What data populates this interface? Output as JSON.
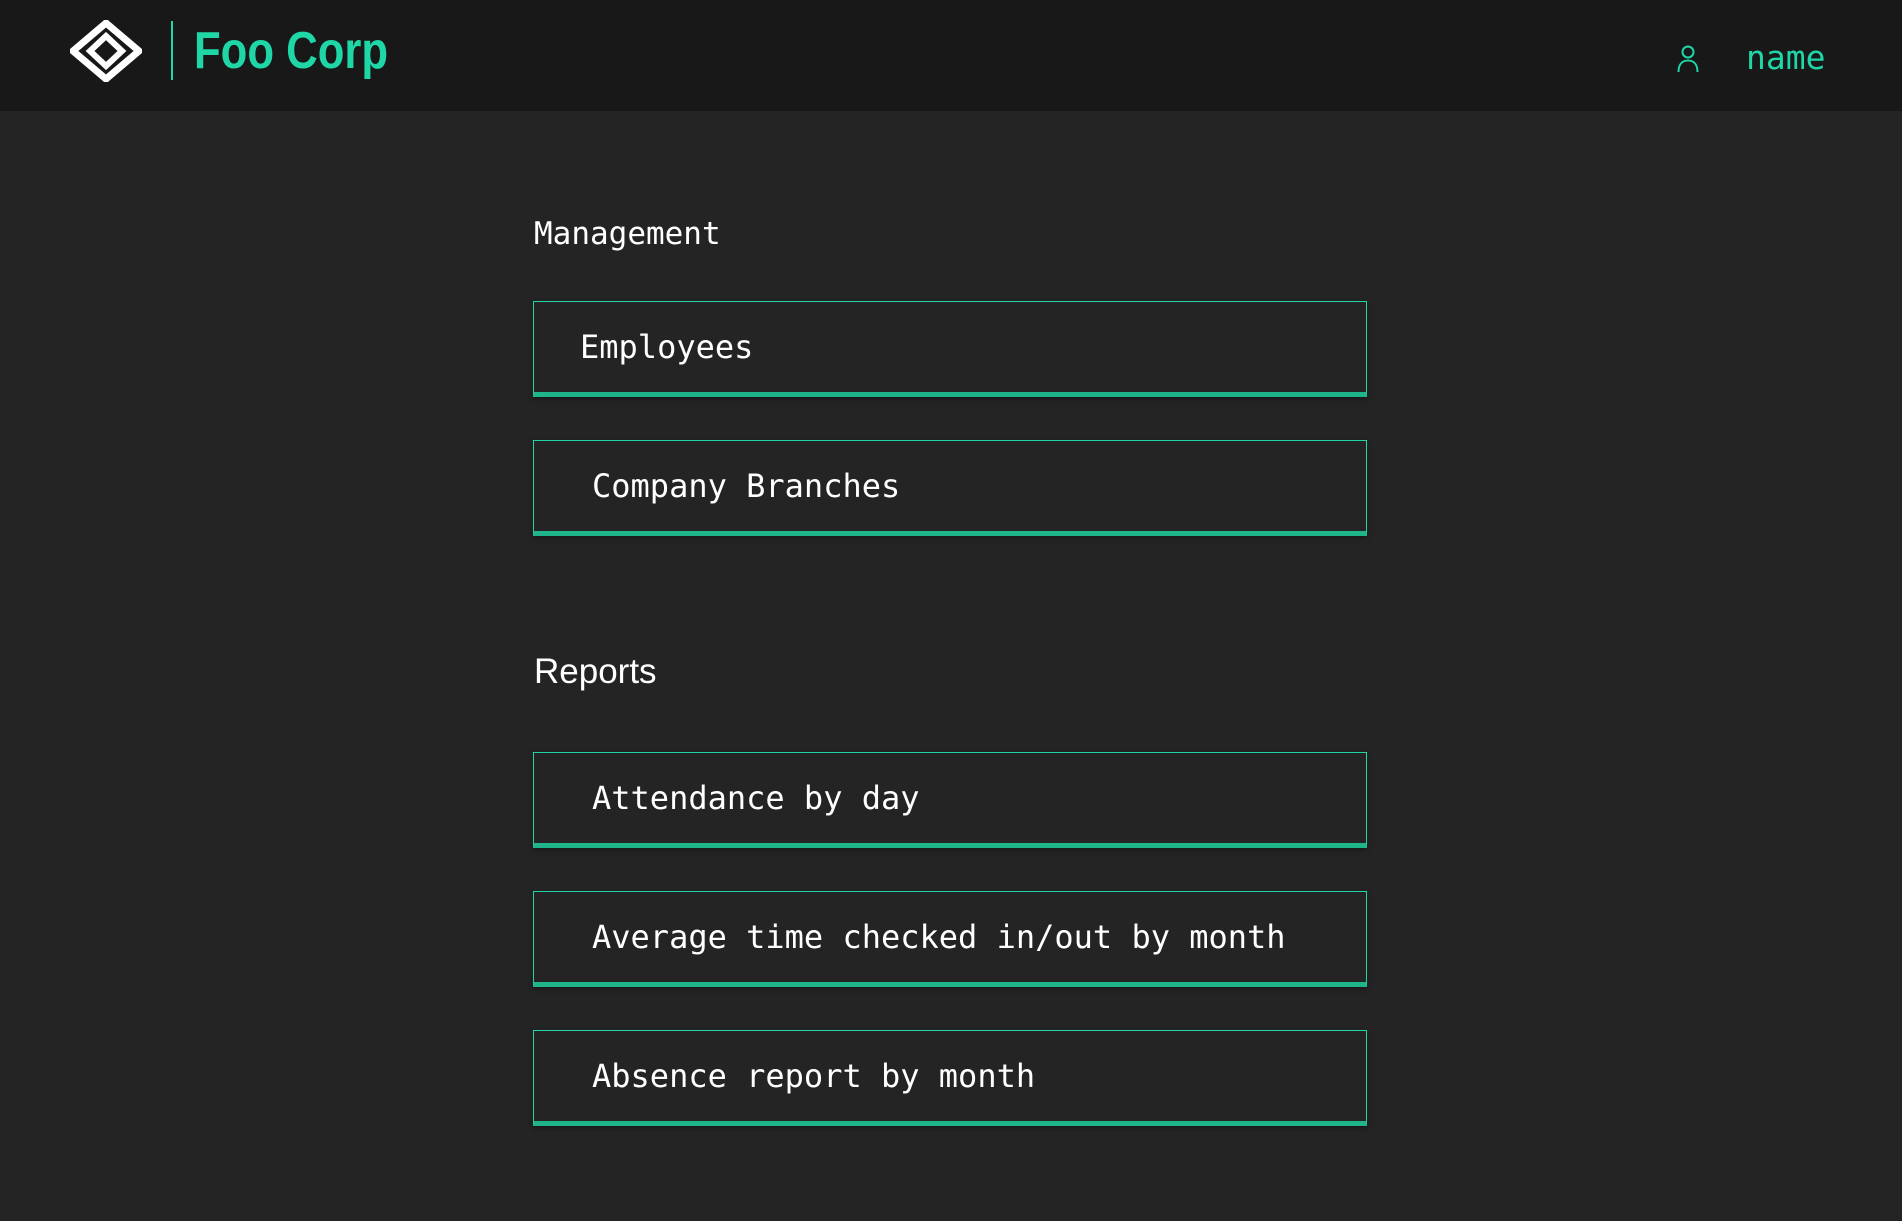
{
  "header": {
    "brand": "Foo Corp",
    "logo_icon": "diamond-logo-icon",
    "user_icon": "user-icon",
    "user_name": "name",
    "accent_color": "#1fd6a6",
    "background_color": "#181818"
  },
  "sections": [
    {
      "title": "Management",
      "items": [
        {
          "label": "Employees"
        },
        {
          "label": "Company Branches"
        }
      ]
    },
    {
      "title": "Reports",
      "items": [
        {
          "label": "Attendance by day"
        },
        {
          "label": "Average time checked in/out by month"
        },
        {
          "label": "Absence report by month"
        }
      ]
    }
  ]
}
